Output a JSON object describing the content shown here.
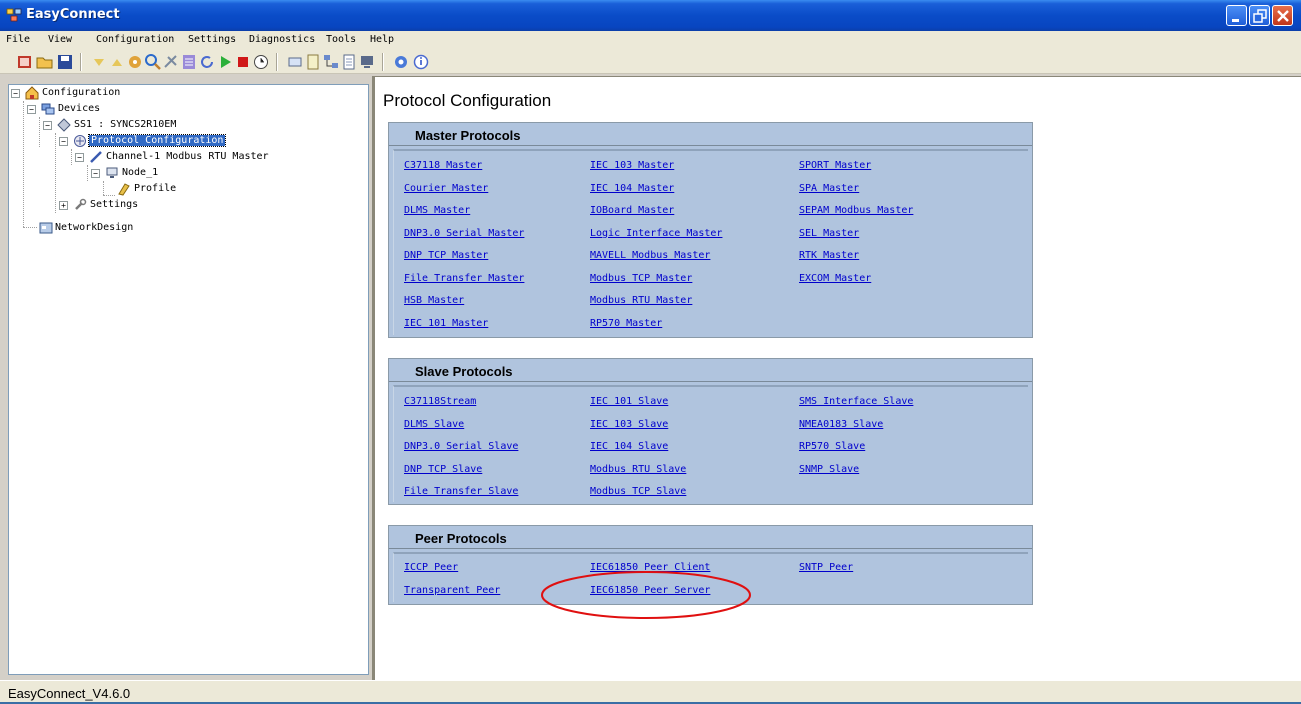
{
  "window": {
    "title": "EasyConnect",
    "app_icon": "easyconnect-app-icon"
  },
  "menu": {
    "items": [
      {
        "label": "File",
        "name": "menu-file"
      },
      {
        "label": "View",
        "name": "menu-view"
      },
      {
        "label": "Configuration",
        "name": "menu-configuration"
      },
      {
        "label": "Settings",
        "name": "menu-settings"
      },
      {
        "label": "Diagnostics",
        "name": "menu-diagnostics"
      },
      {
        "label": "Tools",
        "name": "menu-tools"
      },
      {
        "label": "Help",
        "name": "menu-help"
      }
    ]
  },
  "toolbar": {
    "icons": [
      "new-icon",
      "open-icon",
      "save-icon",
      "move-down-icon",
      "move-up-icon",
      "compile-icon",
      "search-icon",
      "disconnect-icon",
      "list-icon",
      "refresh-icon",
      "run-icon",
      "stop-icon",
      "timer-icon",
      "window-icon",
      "document-icon",
      "network-icon",
      "page-icon",
      "display-icon",
      "settings-icon",
      "about-icon"
    ]
  },
  "tree": {
    "root": "Configuration",
    "devices": "Devices",
    "device": "SS1 : SYNCS2R10EM",
    "protocol_config": "Protocol Configuration",
    "channel": "Channel-1 Modbus RTU Master",
    "node": "Node_1",
    "profile": "Profile",
    "settings": "Settings",
    "network_design": "NetworkDesign"
  },
  "main": {
    "title": "Protocol Configuration",
    "groups": {
      "master": {
        "title": "Master Protocols",
        "col1": [
          "C37118 Master",
          "Courier Master",
          "DLMS Master",
          "DNP3.0 Serial Master",
          "DNP TCP Master",
          "File Transfer Master",
          "HSB Master",
          "IEC 101 Master"
        ],
        "col2": [
          "IEC 103 Master",
          "IEC 104 Master",
          "IOBoard Master",
          "Logic Interface Master",
          "MAVELL Modbus Master",
          "Modbus TCP Master",
          "Modbus RTU Master",
          "RP570 Master"
        ],
        "col3": [
          "SPORT Master",
          "SPA Master",
          "SEPAM Modbus Master",
          "SEL Master",
          "RTK Master",
          "EXCOM Master"
        ]
      },
      "slave": {
        "title": "Slave Protocols",
        "col1": [
          "C37118Stream",
          "DLMS Slave",
          "DNP3.0 Serial Slave",
          "DNP TCP Slave",
          "File Transfer Slave"
        ],
        "col2": [
          "IEC 101 Slave",
          "IEC 103 Slave",
          "IEC 104 Slave",
          "Modbus RTU Slave",
          "Modbus TCP Slave"
        ],
        "col3": [
          "SMS Interface Slave",
          "NMEA0183 Slave",
          "RP570 Slave",
          "SNMP Slave"
        ]
      },
      "peer": {
        "title": "Peer Protocols",
        "col1": [
          "ICCP Peer",
          "Transparent Peer"
        ],
        "col2": [
          "IEC61850 Peer Client",
          "IEC61850 Peer Server"
        ],
        "col3": [
          "SNTP Peer"
        ]
      }
    }
  },
  "status": {
    "version": "EasyConnect_V4.6.0"
  },
  "colors": {
    "panel": "#b0c4de",
    "link": "#0000cc",
    "selection": "#316ac5",
    "annotation": "#e01010"
  }
}
